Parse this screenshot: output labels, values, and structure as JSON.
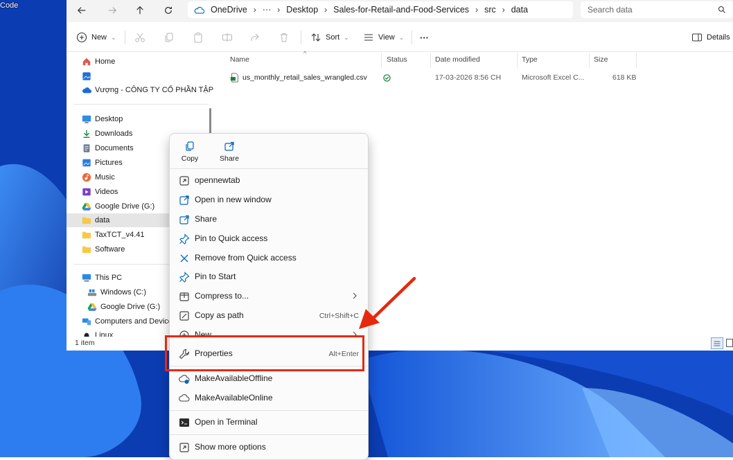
{
  "desktop": {
    "label": "Code"
  },
  "explorer": {
    "breadcrumbs": [
      "OneDrive",
      "···",
      "Desktop",
      "Sales-for-Retail-and-Food-Services",
      "src",
      "data"
    ],
    "search_placeholder": "Search data",
    "toolbar": {
      "new_label": "New",
      "sort_label": "Sort",
      "view_label": "View",
      "more_label": "···",
      "details_label": "Details"
    },
    "sidebar": {
      "items": [
        {
          "label": "Home",
          "icon": "home-icon"
        },
        {
          "label": "",
          "icon": "gallery-icon"
        },
        {
          "label": "Vượng - CÔNG TY CỔ PHẦN TẬP Đ",
          "icon": "onedrive-icon"
        },
        {
          "label": "Desktop",
          "icon": "desktop-icon"
        },
        {
          "label": "Downloads",
          "icon": "download-icon"
        },
        {
          "label": "Documents",
          "icon": "documents-icon"
        },
        {
          "label": "Pictures",
          "icon": "pictures-icon"
        },
        {
          "label": "Music",
          "icon": "music-icon"
        },
        {
          "label": "Videos",
          "icon": "videos-icon"
        },
        {
          "label": "Google Drive (G:)",
          "icon": "google-drive-icon"
        },
        {
          "label": "data",
          "icon": "folder-icon"
        },
        {
          "label": "TaxTCT_v4.41",
          "icon": "folder-icon"
        },
        {
          "label": "Software",
          "icon": "folder-icon"
        },
        {
          "label": "This PC",
          "icon": "pc-icon"
        },
        {
          "label": "Windows (C:)",
          "icon": "drive-icon"
        },
        {
          "label": "Google Drive (G:)",
          "icon": "google-drive-icon"
        },
        {
          "label": "Computers and Devices",
          "icon": "devices-icon"
        },
        {
          "label": "Linux",
          "icon": "linux-icon"
        }
      ]
    },
    "columns": [
      "Name",
      "Status",
      "Date modified",
      "Type",
      "Size"
    ],
    "files": [
      {
        "name": "us_monthly_retail_sales_wrangled.csv",
        "status": "synced",
        "date_modified": "17-03-2026 8:56 CH",
        "type": "Microsoft Excel C...",
        "size": "618 KB"
      }
    ],
    "status_bar": "1 item"
  },
  "context_menu": {
    "quick_actions": [
      {
        "label": "Copy",
        "icon": "copy-icon"
      },
      {
        "label": "Share",
        "icon": "share-icon"
      }
    ],
    "items": [
      {
        "label": "opennewtab",
        "icon": "open-tab-icon"
      },
      {
        "label": "Open in new window",
        "icon": "open-window-icon"
      },
      {
        "label": "Share",
        "icon": "share-icon"
      },
      {
        "label": "Pin to Quick access",
        "icon": "pin-icon"
      },
      {
        "label": "Remove from Quick access",
        "icon": "close-icon"
      },
      {
        "label": "Pin to Start",
        "icon": "pin-icon"
      },
      {
        "label": "Compress to...",
        "icon": "zip-icon"
      },
      {
        "label": "Copy as path",
        "icon": "copy-path-icon",
        "shortcut": "Ctrl+Shift+C"
      },
      {
        "label": "New",
        "icon": "new-icon"
      },
      {
        "label": "Properties",
        "icon": "wrench-icon",
        "shortcut": "Alt+Enter"
      },
      {
        "label": "MakeAvailableOffline",
        "icon": "cloud-download-icon"
      },
      {
        "label": "MakeAvailableOnline",
        "icon": "cloud-icon"
      },
      {
        "label": "Open in Terminal",
        "icon": "terminal-icon"
      },
      {
        "label": "Show more options",
        "icon": "more-options-icon"
      }
    ]
  },
  "colors": {
    "accent": "#0067c0",
    "highlight": "#e5290f",
    "status_synced": "#1e8a3a"
  }
}
